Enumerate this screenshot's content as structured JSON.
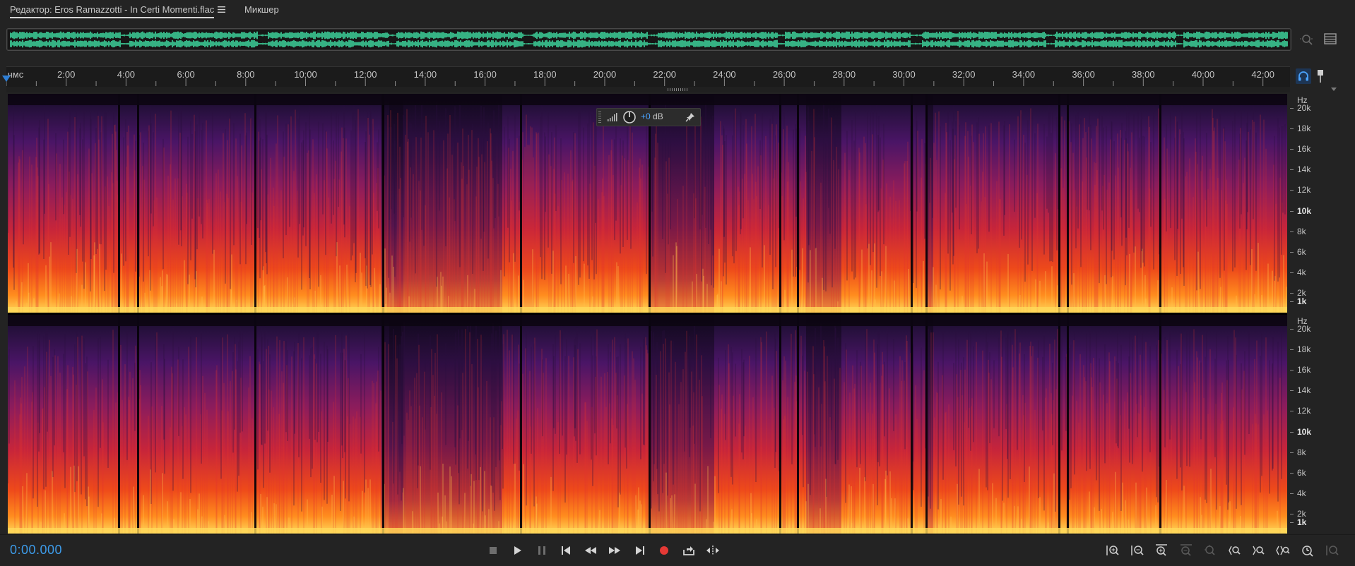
{
  "tabs": {
    "editor_label": "Редактор: Eros Ramazzotti - In Certi Momenti.flac",
    "mixer_label": "Микшер"
  },
  "ruler": {
    "unit_label": "чмс",
    "time_labels": [
      "2:00",
      "4:00",
      "6:00",
      "8:00",
      "10:00",
      "12:00",
      "14:00",
      "16:00",
      "18:00",
      "20:00",
      "22:00",
      "24:00",
      "26:00",
      "28:00",
      "30:00",
      "32:00",
      "34:00",
      "36:00",
      "38:00",
      "40:00",
      "42:00"
    ]
  },
  "frequency_scale": {
    "unit": "Hz",
    "labels": [
      "20k",
      "18k",
      "16k",
      "14k",
      "12k",
      "10k",
      "8k",
      "6k",
      "4k",
      "2k",
      "1k"
    ],
    "bold_labels": [
      "10k",
      "1k"
    ]
  },
  "hud": {
    "plus_sign": "+0",
    "unit": " dB"
  },
  "transport": {
    "time": "0:00.000",
    "buttons": [
      "stop",
      "play",
      "pause",
      "go-to-start",
      "rewind",
      "fast-forward",
      "go-to-end",
      "record",
      "output-to-file",
      "skip-selection"
    ]
  },
  "zoom_tools": [
    "zoom-in-amplitude",
    "zoom-out-amplitude",
    "zoom-in-time",
    "zoom-out-time-disabled",
    "zoom-reset-disabled",
    "zoom-to-selection-left",
    "zoom-to-selection-right",
    "zoom-out-full",
    "zoom-in-selection",
    "zoom-full-disabled"
  ],
  "colors": {
    "accent": "#3d9be9",
    "waveform": "#3fdaa0",
    "record": "#e53935",
    "spectrogram_low": "#ffd15a",
    "spectrogram_mid": "#e0301e",
    "spectrogram_high": "#5a1a6e"
  }
}
